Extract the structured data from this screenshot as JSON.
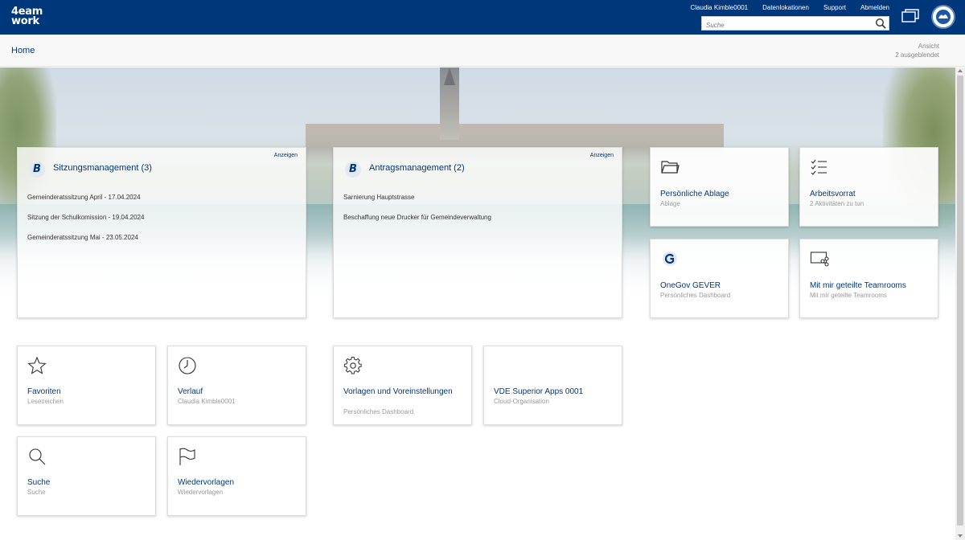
{
  "brand": {
    "logo_line1": "4eam",
    "logo_line2": "work"
  },
  "header": {
    "user": "Claudia Kimble0001",
    "links": [
      "Datenlokationen",
      "Support",
      "Abmelden"
    ],
    "search_placeholder": "Suche"
  },
  "breadcrumb": {
    "home": "Home"
  },
  "view": {
    "label": "Ansicht",
    "hidden": "2 ausgeblendet"
  },
  "widgets": {
    "sitzungen": {
      "title": "Sitzungsmanagement (3)",
      "show": "Anzeigen",
      "items": [
        "Gemeinderatssitzung April - 17.04.2024",
        "Sitzung der Schulkomission - 19.04.2024",
        "Gemeinderatssitzung Mai - 23.05.2024"
      ]
    },
    "antraege": {
      "title": "Antragsmanagement (2)",
      "show": "Anzeigen",
      "items": [
        "Sarnierung Hauptstrasse",
        "Beschaffung neue Drucker für Gemeindeverwaltung"
      ]
    }
  },
  "tiles": {
    "ablage": {
      "title": "Persönliche Ablage",
      "sub": "Ablage",
      "icon": "folder-icon"
    },
    "arbeitsvorrat": {
      "title": "Arbeitsvorrat",
      "sub": "2 Aktivitäten zu tun",
      "icon": "checklist-icon"
    },
    "onegov": {
      "title": "OneGov GEVER",
      "sub": "Persönliches Dashboard",
      "icon": "onegov-icon"
    },
    "teamrooms": {
      "title": "Mit mir geteilte Teamrooms",
      "sub": "Mit mir geteilte Teamrooms",
      "icon": "share-icon"
    },
    "favoriten": {
      "title": "Favoriten",
      "sub": "Lesezeichen",
      "icon": "star-icon"
    },
    "verlauf": {
      "title": "Verlauf",
      "sub": "Claudia Kimble0001",
      "icon": "clock-icon"
    },
    "vorlagen": {
      "title": "Vorlagen und Voreinstellungen",
      "sub": "Persönliches Dashboard",
      "icon": "gear-icon"
    },
    "vde": {
      "title": "VDE Superior Apps 0001",
      "sub": "Cloud-Organisation"
    },
    "suche": {
      "title": "Suche",
      "sub": "Suche",
      "icon": "search-icon"
    },
    "wiedervorlagen": {
      "title": "Wiedervorlagen",
      "sub": "Wiedervorlagen",
      "icon": "flag-icon"
    }
  },
  "colors": {
    "brand": "#00377a",
    "link": "#00377a",
    "muted": "#9a9a9a"
  }
}
